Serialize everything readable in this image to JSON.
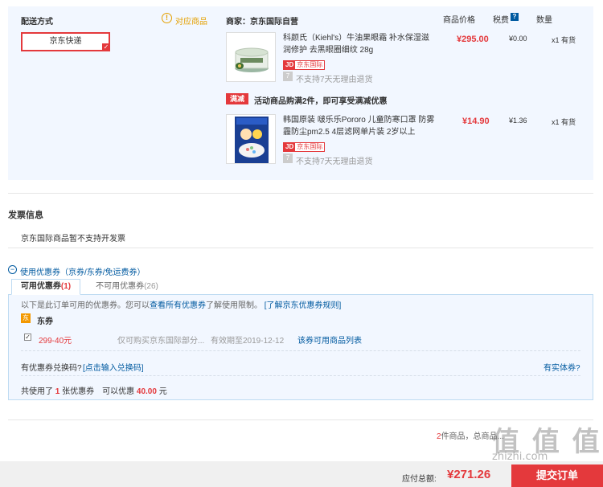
{
  "shipping": {
    "title": "配送方式",
    "match_label": "对应商品",
    "match_icon": "exclamation",
    "method": "京东快递",
    "selected_icon": "check"
  },
  "merchant": {
    "label": "商家：京东国际自营"
  },
  "columns": {
    "price": "商品价格",
    "tax": "税费",
    "qty": "数量"
  },
  "products": [
    {
      "name": "科颜氏（Kiehl's）牛油果眼霜 补水保湿滋润修护 去黑眼圈细纹 28g",
      "price": "¥295.00",
      "tax": "¥0.00",
      "qty": "x1",
      "stock": "有货",
      "badge_jd": "JD",
      "badge_intl": "京东国际",
      "return_note": "不支持7天无理由退货"
    },
    {
      "name": "韩国原装 啵乐乐Pororo 儿童防寒口罩 防雾霾防尘pm2.5 4层滤网单片装 2岁以上",
      "price": "¥14.90",
      "tax": "¥1.36",
      "qty": "x1",
      "stock": "有货",
      "badge_jd": "JD",
      "badge_intl": "京东国际",
      "return_note": "不支持7天无理由退货"
    }
  ],
  "promo": {
    "tag": "满减",
    "text": "活动商品购满2件，即可享受满减优惠"
  },
  "invoice": {
    "title": "发票信息",
    "text": "京东国际商品暂不支持开发票"
  },
  "coupons": {
    "toggle": "−",
    "title": "使用优惠券（京券/东券/免运费券）",
    "tab_available": "可用优惠券",
    "tab_available_count": "(1)",
    "tab_unavailable": "不可用优惠券",
    "tab_unavailable_count": "(26)",
    "info_prefix": "以下是此订单可用的优惠券。您可以",
    "info_link1": "查看所有优惠券",
    "info_middle": "了解使用限制。",
    "info_link2": "[了解京东优惠券规则]",
    "group_icon": "东",
    "group_label": "东券",
    "item": {
      "checked": true,
      "amount": "299-40元",
      "scope": "仅可购买京东国际部分...",
      "valid": "有效期至2019-12-12",
      "list_link": "该券可用商品列表"
    },
    "redeem_question": "有优惠券兑换码?",
    "redeem_link": "[点击输入兑换码]",
    "entity_link": "有实体券?",
    "used_prefix": "共使用了",
    "used_count": "1",
    "used_middle": "张优惠券　可以优惠",
    "used_amount": "40.00",
    "used_suffix": "元"
  },
  "summary": {
    "count": "2",
    "count_label": "件商品，总商品..."
  },
  "footer": {
    "total_label": "应付总额:",
    "total_value": "¥271.26",
    "submit_label": "提交订单"
  },
  "watermark": {
    "text": "值 值 值",
    "url": "zhizhi.com"
  }
}
